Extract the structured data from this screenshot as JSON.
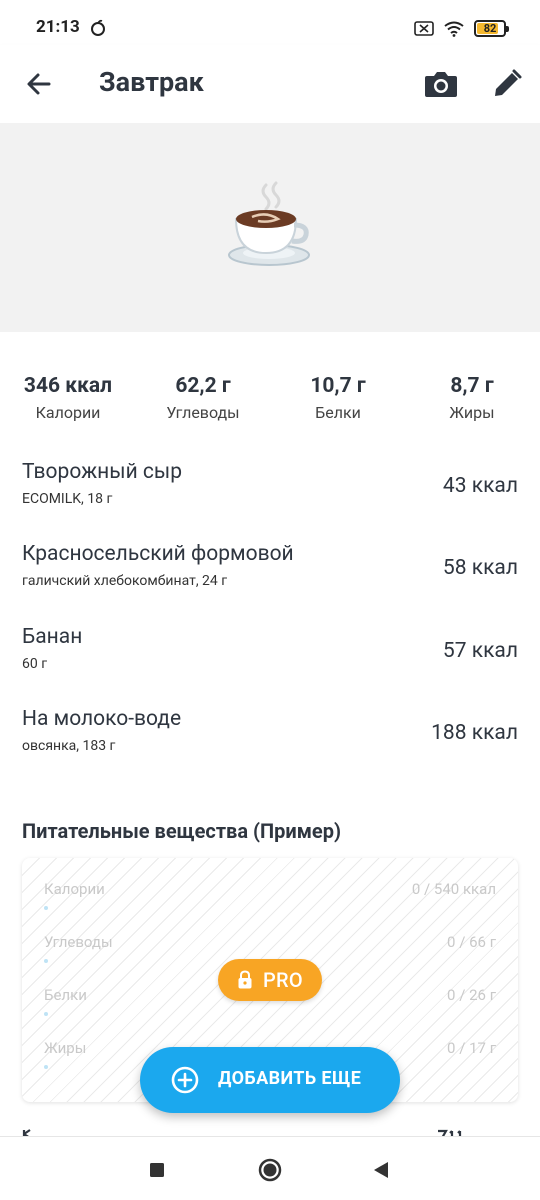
{
  "status_bar": {
    "time": "21:13",
    "battery": "82",
    "battery_level": 0.82
  },
  "header": {
    "title": "Завтрак",
    "back_icon": "arrow-back-icon",
    "camera_icon": "camera-icon",
    "edit_icon": "pencil-icon"
  },
  "hero": {
    "icon": "coffee-cup-icon"
  },
  "summary": [
    {
      "value": "346 ккал",
      "label": "Калории"
    },
    {
      "value": "62,2 г",
      "label": "Углеводы"
    },
    {
      "value": "10,7 г",
      "label": "Белки"
    },
    {
      "value": "8,7 г",
      "label": "Жиры"
    }
  ],
  "foods": [
    {
      "name": "Творожный сыр",
      "desc": "ECOMILK, 18 г",
      "kcal": "43 ккал"
    },
    {
      "name": "Красносельский формовой",
      "desc": "галичский хлебокомбинат, 24 г",
      "kcal": "58 ккал"
    },
    {
      "name": "Банан",
      "desc": "60 г",
      "kcal": "57 ккал"
    },
    {
      "name": "На молоко-воде",
      "desc": "овсянка, 183 г",
      "kcal": "188 ккал"
    }
  ],
  "nutrients": {
    "title": "Питательные вещества (Пример)",
    "rows": [
      {
        "label": "Калории",
        "value": "0 / 540 ккал",
        "progress": 0
      },
      {
        "label": "Углеводы",
        "value": "0 / 66 г",
        "progress": 0
      },
      {
        "label": "Белки",
        "value": "0 / 26 г",
        "progress": 0
      },
      {
        "label": "Жиры",
        "value": "0 / 17 г",
        "progress": 0
      }
    ],
    "pro_badge": "PRO",
    "pro_icon": "lock-icon"
  },
  "fab": {
    "label": "ДОБАВИТЬ ЕЩЕ",
    "icon": "plus-circle-icon"
  },
  "nav_bar": {
    "recents_icon": "square-icon",
    "home_icon": "circle-icon",
    "back_icon": "triangle-back-icon"
  },
  "colors": {
    "accent": "#1ba8ee",
    "pro": "#f8a524",
    "text": "#2f3640",
    "hero_bg": "#f2f2f2"
  }
}
